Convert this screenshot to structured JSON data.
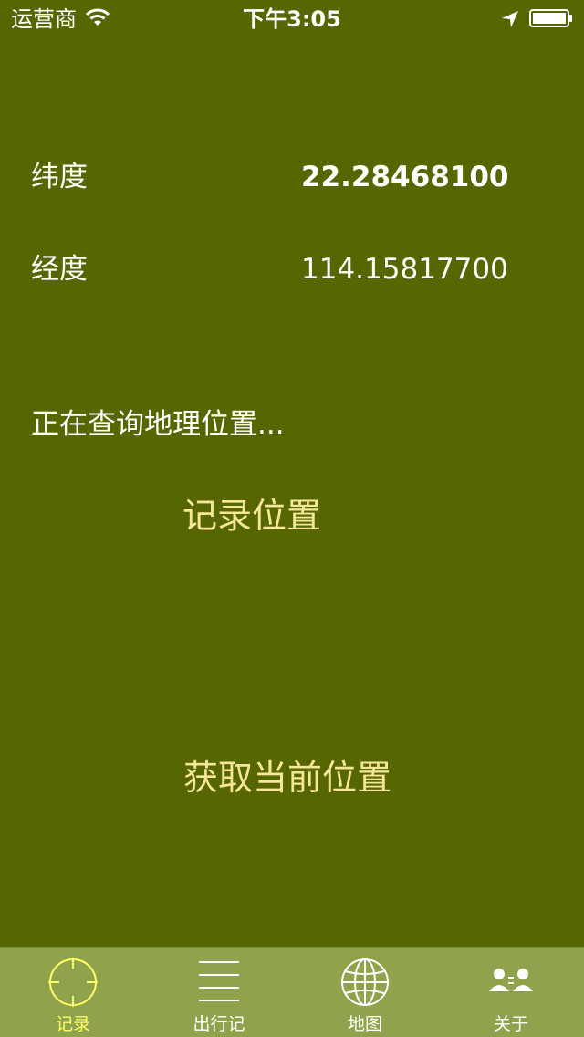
{
  "status_bar": {
    "carrier": "运营商",
    "time": "下午3:05"
  },
  "location": {
    "latitude_label": "纬度",
    "latitude_value": "22.28468100",
    "longitude_label": "经度",
    "longitude_value": "114.15817700"
  },
  "status_text": "正在查询地理位置...",
  "actions": {
    "record_label": "记录位置",
    "get_location_label": "获取当前位置"
  },
  "colors": {
    "background": "#566600",
    "tab_bar": "#8ea34b",
    "button_text": "#f6e69a",
    "active_tab": "#ffff66"
  },
  "tab_bar": {
    "items": [
      {
        "label": "记录",
        "icon": "crosshair-icon",
        "active": true
      },
      {
        "label": "出行记",
        "icon": "list-lines-icon",
        "active": false
      },
      {
        "label": "地图",
        "icon": "globe-icon",
        "active": false
      },
      {
        "label": "关于",
        "icon": "people-icon",
        "active": false
      }
    ]
  }
}
